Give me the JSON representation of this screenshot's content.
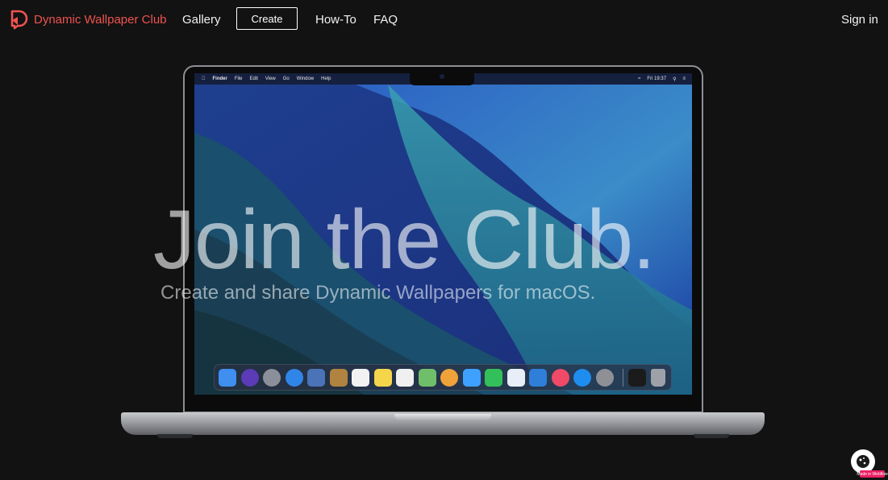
{
  "brand": {
    "name": "Dynamic Wallpaper Club",
    "accent": "#ef5350"
  },
  "nav": {
    "gallery": "Gallery",
    "create": "Create",
    "howto": "How-To",
    "faq": "FAQ",
    "signin": "Sign in"
  },
  "hero": {
    "title": "Join the Club.",
    "subtitle": "Create and share Dynamic Wallpapers for macOS."
  },
  "mac_menubar": {
    "apple": "",
    "items": [
      "Finder",
      "File",
      "Edit",
      "View",
      "Go",
      "Window",
      "Help"
    ],
    "clock": "Fri 19:37"
  },
  "dock": {
    "apps": [
      {
        "name": "finder-icon",
        "color": "#3f8ef0"
      },
      {
        "name": "siri-icon",
        "color": "#5b3bb7"
      },
      {
        "name": "launchpad-icon",
        "color": "#8a8f99"
      },
      {
        "name": "safari-icon",
        "color": "#2f86e8"
      },
      {
        "name": "preview-icon",
        "color": "#4a73b8"
      },
      {
        "name": "notes-book-icon",
        "color": "#b08440"
      },
      {
        "name": "calendar-icon",
        "color": "#f2f2f2"
      },
      {
        "name": "notes-icon",
        "color": "#f5d54a"
      },
      {
        "name": "reminders-icon",
        "color": "#f0f0f0"
      },
      {
        "name": "maps-icon",
        "color": "#6fbf6a"
      },
      {
        "name": "photos-icon",
        "color": "#f0a23a"
      },
      {
        "name": "messages-icon",
        "color": "#3ea0ff"
      },
      {
        "name": "facetime-icon",
        "color": "#33c05a"
      },
      {
        "name": "keynote-icon",
        "color": "#e7eef8"
      },
      {
        "name": "presentation-icon",
        "color": "#2f7ed8"
      },
      {
        "name": "music-icon",
        "color": "#f04a68"
      },
      {
        "name": "app-store-icon",
        "color": "#1f8cf0"
      },
      {
        "name": "system-preferences-icon",
        "color": "#8e9096"
      },
      {
        "name": "terminal-icon",
        "color": "#1b1b1b"
      },
      {
        "name": "trash-icon",
        "color": "#9ea2a8"
      }
    ]
  },
  "cookie": {
    "badge": "Made in Webflow"
  }
}
